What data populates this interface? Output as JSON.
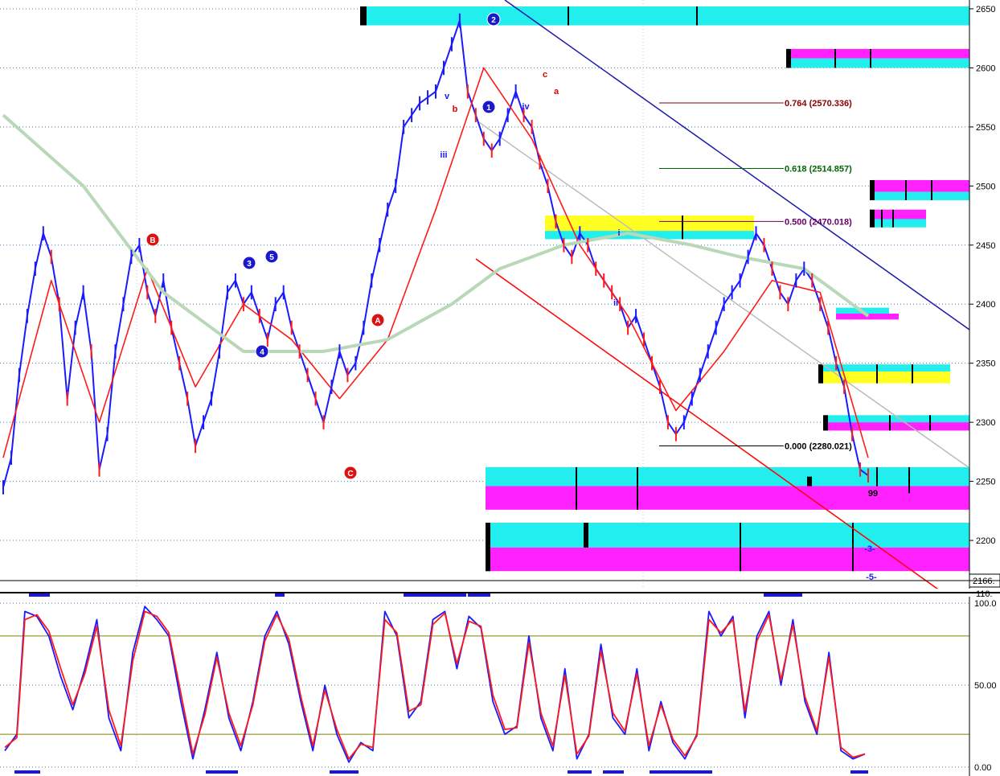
{
  "chart_data": [
    {
      "type": "line",
      "panel": "price",
      "title": "",
      "ylim": [
        2166,
        2652
      ],
      "yticks": [
        {
          "value": 2650,
          "label": "2650"
        },
        {
          "value": 2600,
          "label": "2600"
        },
        {
          "value": 2550,
          "label": "2550"
        },
        {
          "value": 2500,
          "label": "2500"
        },
        {
          "value": 2450,
          "label": "2450"
        },
        {
          "value": 2400,
          "label": "2400"
        },
        {
          "value": 2350,
          "label": "2350"
        },
        {
          "value": 2300,
          "label": "2300"
        },
        {
          "value": 2250,
          "label": "2250"
        },
        {
          "value": 2200,
          "label": "2200"
        }
      ],
      "last_value_label": "2166.",
      "grid": true,
      "colors": {
        "up": "#1a1aff",
        "down": "#ff1a1a",
        "neutral": "#000000",
        "ma_long": "#b8d8b8",
        "ma_mid": "#cc33cc",
        "trend_blue": "#1a1aaa",
        "trend_red": "#ff0000",
        "trend_gray": "#bbbbbb",
        "cyan": "#22eeee",
        "magenta": "#ff22ff",
        "yellow": "#ffff22"
      },
      "series": [
        {
          "role": "price",
          "x": [
            0,
            10,
            20,
            30,
            40,
            50,
            60,
            70,
            80,
            90,
            100,
            110,
            120,
            130,
            140,
            150,
            160,
            170,
            180,
            190,
            200,
            210,
            220,
            230,
            240,
            250,
            260,
            270,
            280,
            290,
            300,
            310,
            320,
            330,
            340,
            350,
            360,
            370,
            380,
            390,
            400,
            410,
            420,
            430,
            440,
            450,
            460,
            470,
            480,
            490,
            500,
            510,
            520,
            530,
            540,
            550,
            560,
            570,
            580,
            590,
            600,
            610,
            620,
            630,
            640,
            650,
            660,
            670,
            680,
            690,
            700,
            710,
            720,
            730,
            740,
            750,
            760,
            770,
            780,
            790,
            800,
            810,
            820,
            830,
            840,
            850,
            860,
            870,
            880,
            890,
            900,
            910,
            920,
            930,
            940,
            950,
            960,
            970,
            980,
            990,
            1000,
            1010,
            1020,
            1030,
            1040,
            1050,
            1060,
            1070,
            1080
          ],
          "values": [
            2245,
            2270,
            2340,
            2390,
            2430,
            2460,
            2440,
            2400,
            2320,
            2380,
            2410,
            2360,
            2260,
            2290,
            2360,
            2400,
            2440,
            2450,
            2410,
            2390,
            2420,
            2380,
            2350,
            2320,
            2280,
            2300,
            2320,
            2360,
            2410,
            2420,
            2400,
            2410,
            2390,
            2370,
            2400,
            2410,
            2380,
            2360,
            2340,
            2320,
            2300,
            2330,
            2360,
            2340,
            2350,
            2380,
            2420,
            2450,
            2480,
            2500,
            2550,
            2560,
            2570,
            2575,
            2580,
            2600,
            2620,
            2640,
            2580,
            2560,
            2540,
            2530,
            2540,
            2560,
            2580,
            2560,
            2550,
            2520,
            2500,
            2470,
            2450,
            2440,
            2460,
            2450,
            2430,
            2420,
            2410,
            2400,
            2380,
            2390,
            2370,
            2350,
            2330,
            2300,
            2290,
            2300,
            2320,
            2340,
            2360,
            2380,
            2400,
            2410,
            2420,
            2440,
            2460,
            2450,
            2430,
            2410,
            2400,
            2420,
            2430,
            2420,
            2400,
            2380,
            2350,
            2330,
            2290,
            2260,
            2255
          ]
        },
        {
          "role": "fast_ma",
          "x": [
            0,
            60,
            120,
            180,
            240,
            300,
            360,
            420,
            480,
            540,
            600,
            660,
            720,
            780,
            840,
            900,
            960,
            1020,
            1080
          ],
          "values": [
            2270,
            2420,
            2300,
            2430,
            2330,
            2400,
            2370,
            2320,
            2370,
            2480,
            2600,
            2540,
            2450,
            2390,
            2310,
            2360,
            2420,
            2410,
            2270
          ]
        },
        {
          "role": "slow_ma",
          "x": [
            0,
            100,
            200,
            300,
            400,
            480,
            560,
            620,
            700,
            780,
            860,
            920,
            1000,
            1040,
            1080
          ],
          "values": [
            2560,
            2500,
            2410,
            2360,
            2360,
            2370,
            2400,
            2430,
            2450,
            2460,
            2450,
            2440,
            2430,
            2410,
            2390
          ]
        }
      ],
      "fib_levels": [
        {
          "ratio": "0.764",
          "value": "2570.336",
          "color": "#880000"
        },
        {
          "ratio": "0.618",
          "value": "2514.857",
          "color": "#006600"
        },
        {
          "ratio": "0.500",
          "value": "2470.018",
          "color": "#660066"
        },
        {
          "ratio": "0.000",
          "value": "2280.021",
          "color": "#000000"
        }
      ],
      "fib_labels": [
        "0.764 (2570.336)",
        "0.618 (2514.857)",
        "0.500 (2470.018)",
        "0.000 (2280.021)"
      ],
      "zones": [
        {
          "color": "cyan",
          "top": 2652,
          "bottom": 2636
        },
        {
          "color": "magenta",
          "top": 2616,
          "bottom": 2608
        },
        {
          "color": "cyan",
          "top": 2608,
          "bottom": 2600
        },
        {
          "color": "magenta",
          "top": 2505,
          "bottom": 2495
        },
        {
          "color": "cyan",
          "top": 2495,
          "bottom": 2488
        },
        {
          "color": "magenta",
          "top": 2480,
          "bottom": 2472
        },
        {
          "color": "cyan",
          "top": 2472,
          "bottom": 2465
        },
        {
          "color": "yellow",
          "top": 2475,
          "bottom": 2462
        },
        {
          "color": "cyan",
          "top": 2462,
          "bottom": 2455
        },
        {
          "color": "cyan",
          "top": 2397,
          "bottom": 2392
        },
        {
          "color": "magenta",
          "top": 2392,
          "bottom": 2387
        },
        {
          "color": "cyan",
          "top": 2349,
          "bottom": 2343
        },
        {
          "color": "yellow",
          "top": 2343,
          "bottom": 2333
        },
        {
          "color": "cyan",
          "top": 2306,
          "bottom": 2300
        },
        {
          "color": "magenta",
          "top": 2300,
          "bottom": 2293
        },
        {
          "color": "cyan",
          "top": 2262,
          "bottom": 2246
        },
        {
          "color": "magenta",
          "top": 2246,
          "bottom": 2226
        },
        {
          "color": "cyan",
          "top": 2215,
          "bottom": 2194
        },
        {
          "color": "magenta",
          "top": 2194,
          "bottom": 2174
        }
      ],
      "wave_labels": [
        {
          "text": "1",
          "circled": true,
          "color": "blue"
        },
        {
          "text": "2",
          "circled": true,
          "color": "blue"
        },
        {
          "text": "3",
          "circled": true,
          "color": "blue"
        },
        {
          "text": "4",
          "circled": true,
          "color": "blue"
        },
        {
          "text": "5",
          "circled": true,
          "color": "blue"
        },
        {
          "text": "A",
          "circled": true,
          "color": "red"
        },
        {
          "text": "B",
          "circled": true,
          "color": "red"
        },
        {
          "text": "C",
          "circled": true,
          "color": "red"
        },
        {
          "text": "i",
          "circled": false,
          "color": "blue"
        },
        {
          "text": "ii",
          "circled": false,
          "color": "blue"
        },
        {
          "text": "iii",
          "circled": false,
          "color": "blue"
        },
        {
          "text": "iv",
          "circled": false,
          "color": "blue"
        },
        {
          "text": "v",
          "circled": false,
          "color": "blue"
        },
        {
          "text": "a",
          "circled": false,
          "color": "red"
        },
        {
          "text": "b",
          "circled": false,
          "color": "red"
        },
        {
          "text": "c",
          "circled": false,
          "color": "red"
        },
        {
          "text": "99",
          "circled": false,
          "color": "black"
        },
        {
          "text": "-3-",
          "circled": false,
          "color": "blue"
        },
        {
          "text": "-5-",
          "circled": false,
          "color": "blue"
        }
      ]
    },
    {
      "type": "line",
      "panel": "oscillator",
      "ylim": [
        -2,
        104
      ],
      "yticks": [
        {
          "value": 100,
          "label": "100.0"
        },
        {
          "value": 50,
          "label": "50.00"
        },
        {
          "value": 0,
          "label": "0.00"
        }
      ],
      "top_clip_label": "110.",
      "reference_levels": [
        80,
        20
      ],
      "series": [
        {
          "role": "k",
          "color": "#1a1aff",
          "x": [
            0,
            15,
            25,
            40,
            55,
            70,
            85,
            100,
            115,
            130,
            145,
            160,
            175,
            190,
            205,
            220,
            235,
            250,
            265,
            280,
            295,
            310,
            325,
            340,
            355,
            370,
            385,
            400,
            415,
            430,
            445,
            460,
            475,
            490,
            505,
            520,
            535,
            550,
            565,
            580,
            595,
            610,
            625,
            640,
            655,
            670,
            685,
            700,
            715,
            730,
            745,
            760,
            775,
            790,
            805,
            820,
            835,
            850,
            865,
            880,
            895,
            910,
            925,
            940,
            955,
            970,
            985,
            1000,
            1015,
            1030,
            1045,
            1060,
            1075
          ],
          "values": [
            10,
            20,
            95,
            92,
            80,
            55,
            35,
            60,
            90,
            30,
            10,
            70,
            98,
            90,
            80,
            40,
            5,
            35,
            70,
            30,
            10,
            40,
            80,
            95,
            75,
            40,
            10,
            50,
            20,
            3,
            15,
            10,
            95,
            80,
            30,
            40,
            90,
            95,
            60,
            92,
            85,
            40,
            20,
            25,
            80,
            30,
            10,
            60,
            5,
            20,
            75,
            30,
            20,
            60,
            10,
            40,
            15,
            5,
            20,
            95,
            80,
            92,
            30,
            80,
            95,
            50,
            90,
            40,
            20,
            70,
            10,
            5,
            8
          ]
        },
        {
          "role": "d",
          "color": "#ff1a1a",
          "x": [
            0,
            15,
            25,
            40,
            55,
            70,
            85,
            100,
            115,
            130,
            145,
            160,
            175,
            190,
            205,
            220,
            235,
            250,
            265,
            280,
            295,
            310,
            325,
            340,
            355,
            370,
            385,
            400,
            415,
            430,
            445,
            460,
            475,
            490,
            505,
            520,
            535,
            550,
            565,
            580,
            595,
            610,
            625,
            640,
            655,
            670,
            685,
            700,
            715,
            730,
            745,
            760,
            775,
            790,
            805,
            820,
            835,
            850,
            865,
            880,
            895,
            910,
            925,
            940,
            955,
            970,
            985,
            1000,
            1015,
            1030,
            1045,
            1060,
            1075
          ],
          "values": [
            12,
            18,
            90,
            93,
            83,
            60,
            38,
            57,
            86,
            35,
            13,
            65,
            95,
            92,
            82,
            45,
            8,
            32,
            67,
            33,
            13,
            38,
            77,
            93,
            78,
            43,
            13,
            47,
            23,
            5,
            14,
            12,
            90,
            82,
            34,
            38,
            87,
            94,
            63,
            89,
            86,
            44,
            23,
            24,
            76,
            33,
            13,
            56,
            8,
            19,
            71,
            33,
            22,
            57,
            13,
            38,
            17,
            7,
            19,
            90,
            82,
            90,
            34,
            77,
            93,
            53,
            87,
            43,
            22,
            67,
            12,
            6,
            8
          ]
        }
      ]
    }
  ]
}
